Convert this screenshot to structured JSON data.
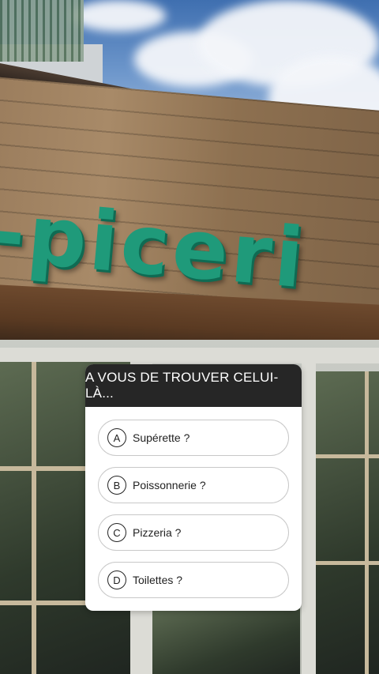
{
  "sign": {
    "text": "-piceri"
  },
  "quiz": {
    "title": "A VOUS DE TROUVER CELUI-LÀ...",
    "options": [
      {
        "letter": "A",
        "label": "Supérette ?"
      },
      {
        "letter": "B",
        "label": "Poissonnerie ?"
      },
      {
        "letter": "C",
        "label": "Pizzeria ?"
      },
      {
        "letter": "D",
        "label": "Toilettes ?"
      }
    ]
  },
  "colors": {
    "sign_green": "#1f9a7a",
    "header_dark": "#262626",
    "card_white": "#ffffff"
  }
}
